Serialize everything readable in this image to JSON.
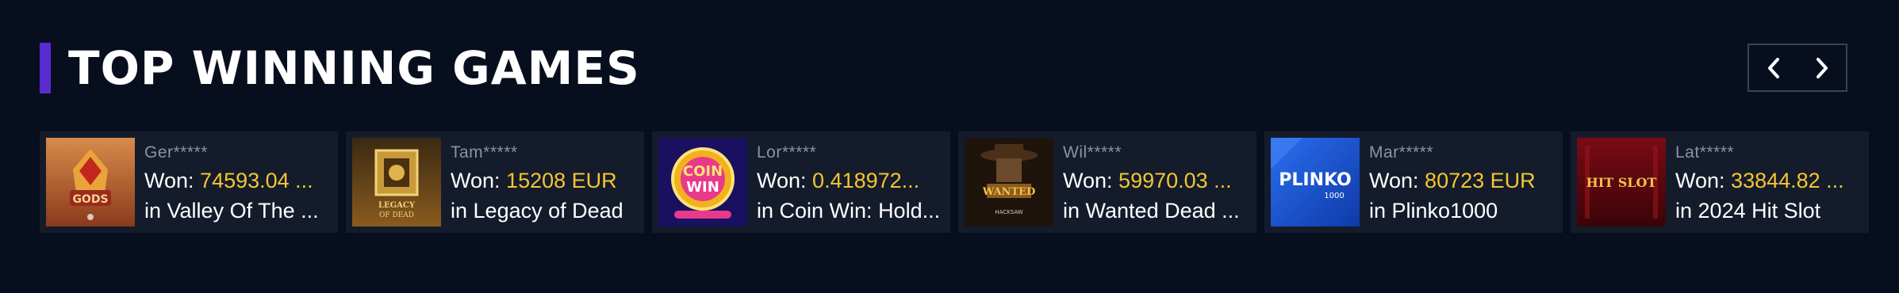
{
  "section": {
    "title": "TOP WINNING GAMES",
    "accent_color": "#5a2bd1"
  },
  "nav": {
    "prev_icon": "chevron-left-icon",
    "next_icon": "chevron-right-icon"
  },
  "wins": [
    {
      "user": "Ger*****",
      "won_label": "Won:",
      "amount": "74593.04 ...",
      "prefix": "in",
      "game": "Valley Of The ...",
      "thumb_text": "GODS",
      "thumb_color": "#b5502a"
    },
    {
      "user": "Tam*****",
      "won_label": "Won:",
      "amount": "15208 EUR",
      "prefix": "in",
      "game": "Legacy of Dead",
      "thumb_text": "LEGACY OF DEAD",
      "thumb_color": "#7a5a1e"
    },
    {
      "user": "Lor*****",
      "won_label": "Won:",
      "amount": "0.418972...",
      "prefix": "in",
      "game": "Coin Win: Hold...",
      "thumb_text": "COIN WIN",
      "thumb_color": "#2a1a6e"
    },
    {
      "user": "Wil*****",
      "won_label": "Won:",
      "amount": "59970.03 ...",
      "prefix": "in",
      "game": "Wanted Dead ...",
      "thumb_text": "WANTED",
      "thumb_color": "#3d2a18"
    },
    {
      "user": "Mar*****",
      "won_label": "Won:",
      "amount": "80723 EUR",
      "prefix": "in",
      "game": "Plinko1000",
      "thumb_text": "PLINKO",
      "thumb_subtext": "1000",
      "thumb_color": "#1f5fd6"
    },
    {
      "user": "Lat*****",
      "won_label": "Won:",
      "amount": "33844.82 ...",
      "prefix": "in",
      "game": "2024 Hit Slot",
      "thumb_text": "HIT SLOT",
      "thumb_color": "#5a0a10"
    }
  ],
  "colors": {
    "background": "#070e1e",
    "card": "#141c2b",
    "amount": "#f5c531",
    "username": "#8b93a3"
  }
}
